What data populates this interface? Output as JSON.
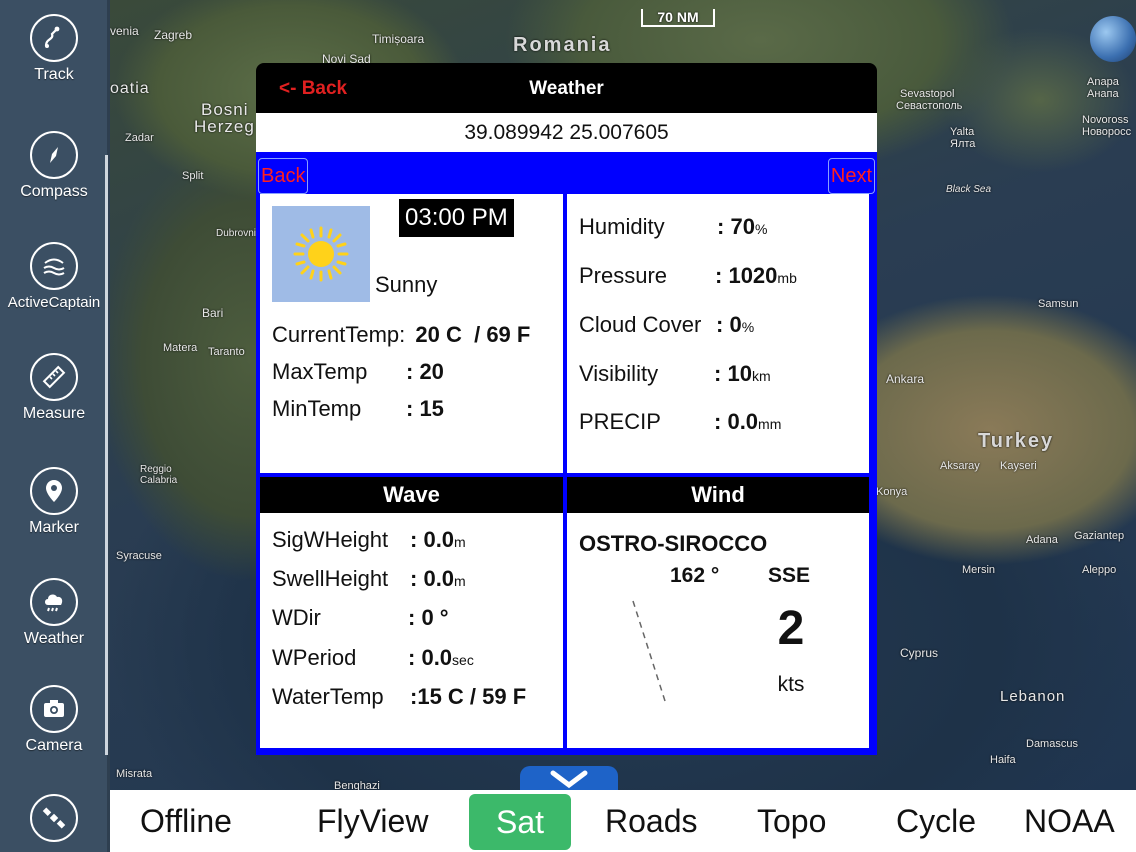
{
  "sidebar": {
    "items": [
      {
        "label": "Track",
        "icon": "track-icon"
      },
      {
        "label": "Compass",
        "icon": "compass-icon"
      },
      {
        "label": "ActiveCaptain",
        "icon": "activecaptain-icon"
      },
      {
        "label": "Measure",
        "icon": "ruler-icon"
      },
      {
        "label": "Marker",
        "icon": "map-pin-icon"
      },
      {
        "label": "Weather",
        "icon": "cloud-rain-icon"
      },
      {
        "label": "Camera",
        "icon": "camera-icon"
      },
      {
        "label": "",
        "icon": "satellite-icon"
      }
    ]
  },
  "map": {
    "scale": "70 NM",
    "labels": {
      "romania": "Romania",
      "turkey": "Turkey",
      "bosnia": "Bosni",
      "herzeg": "Herzeg",
      "zagreb": "Zagreb",
      "timisoara": "Timișoara",
      "novi_sad": "Novi Sad",
      "croatia": "oatia",
      "slovenia": "venia",
      "sevastopol": "Sevastopol",
      "sevastopol_cy": "Севастополь",
      "yalta": "Yalta",
      "yalta_cy": "Ялта",
      "anapa": "Anapa",
      "anapa_cy": "Анапа",
      "novoross": "Novoross",
      "novoross_cy": "Новоросс",
      "black_sea": "Black Sea",
      "samsun": "Samsun",
      "ankara": "Ankara",
      "kayseri": "Kayseri",
      "aksaray": "Aksaray",
      "konya": "Konya",
      "adana": "Adana",
      "mersin": "Mersin",
      "gaziantep": "Gaziantep",
      "aleppo": "Aleppo",
      "cyprus": "Cyprus",
      "lebanon": "Lebanon",
      "damascus": "Damascus",
      "haifa": "Haifa",
      "bari": "Bari",
      "matera": "Matera",
      "taranto": "Taranto",
      "reggio": "Reggio Calabria",
      "syracuse": "Syracuse",
      "misrata": "Misrata",
      "benghazi": "Benghazi",
      "zadar": "Zadar",
      "split": "Split",
      "dubrovnik": "Dubrovni"
    }
  },
  "dialog": {
    "back": "<- Back",
    "title": "Weather",
    "coordinates": "39.089942 25.007605",
    "nav_back": "Back",
    "nav_next": "Next",
    "time": "03:00 PM",
    "condition": "Sunny",
    "current_temp_label": "CurrentTemp:",
    "current_temp_value": "20 C  / 69 F",
    "max_temp_label": "MaxTemp",
    "max_temp_value": ": 20",
    "min_temp_label": "MinTemp",
    "min_temp_value": ": 15",
    "humidity_label": "Humidity",
    "humidity_value": "70",
    "humidity_unit": "%",
    "pressure_label": "Pressure",
    "pressure_value": "1020",
    "pressure_unit": "mb",
    "cloud_label": "Cloud Cover",
    "cloud_value": "0",
    "cloud_unit": "%",
    "visibility_label": "Visibility",
    "visibility_value": "10",
    "visibility_unit": "km",
    "precip_label": "PRECIP",
    "precip_value": "0.0",
    "precip_unit": "mm",
    "wave_title": "Wave",
    "sigw_label": "SigWHeight",
    "sigw_value": "0.0",
    "sigw_unit": "m",
    "swell_label": "SwellHeight",
    "swell_value": "0.0",
    "swell_unit": "m",
    "wdir_label": "WDir",
    "wdir_value": "0 °",
    "wperiod_label": "WPeriod",
    "wperiod_value": "0.0",
    "wperiod_unit": "sec",
    "watertemp_label": "WaterTemp",
    "watertemp_value": "15 C / 59 F",
    "wind_title": "Wind",
    "wind_name": "OSTRO-SIROCCO",
    "wind_degrees": "162 °",
    "wind_cardinal": "SSE",
    "wind_speed": "2",
    "wind_unit": "kts"
  },
  "bottombar": {
    "options": [
      "Offline",
      "FlyView",
      "Sat",
      "Roads",
      "Topo",
      "Cycle",
      "NOAA"
    ],
    "selected": "Sat"
  },
  "colors": {
    "accent_blue": "#0000ff",
    "back_red": "#e02020",
    "selected_green": "#3cb96a",
    "sidebar": "#3b4f63"
  }
}
